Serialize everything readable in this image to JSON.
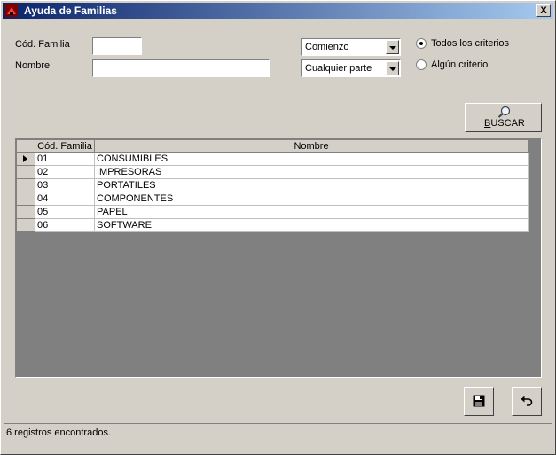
{
  "window": {
    "title": "Ayuda de Familias",
    "close_label": "X"
  },
  "form": {
    "cod_label": "Cód. Familia",
    "cod_value": "",
    "nombre_label": "Nombre",
    "nombre_value": "",
    "combo1": "Comienzo",
    "combo2": "Cualquier parte",
    "radio1": "Todos los criterios",
    "radio2": "Algún criterio",
    "radio_selected": "radio1"
  },
  "buscar": {
    "label_first": "B",
    "label_rest": "USCAR"
  },
  "grid": {
    "headers": [
      "Cód. Familia",
      "Nombre"
    ],
    "rows": [
      [
        "01",
        "CONSUMIBLES"
      ],
      [
        "02",
        "IMPRESORAS"
      ],
      [
        "03",
        "PORTATILES"
      ],
      [
        "04",
        "COMPONENTES"
      ],
      [
        "05",
        "PAPEL"
      ],
      [
        "06",
        "SOFTWARE"
      ]
    ]
  },
  "status": {
    "text": "6 registros encontrados."
  }
}
